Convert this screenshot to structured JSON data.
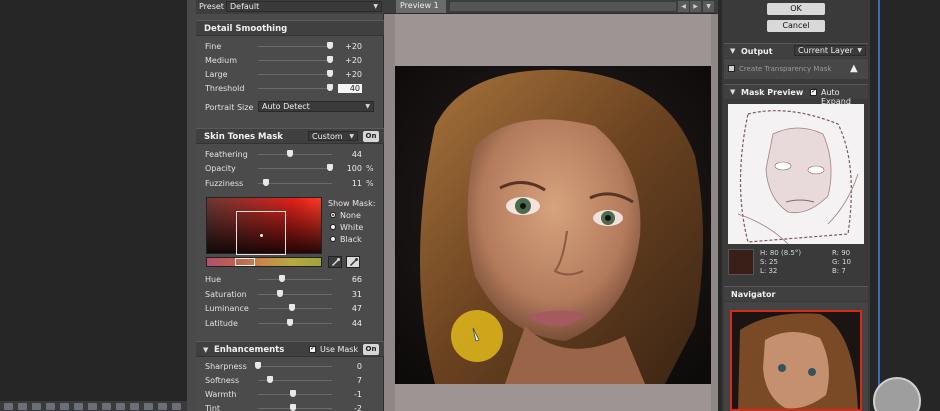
{
  "preset": {
    "label": "Preset",
    "value": "Default"
  },
  "detail_smoothing": {
    "title": "Detail Smoothing",
    "sliders": [
      {
        "label": "Fine",
        "value": "+20",
        "level": 1.0
      },
      {
        "label": "Medium",
        "value": "+20",
        "level": 1.0
      },
      {
        "label": "Large",
        "value": "+20",
        "level": 1.0
      },
      {
        "label": "Threshold",
        "value": "40",
        "level": 1.0
      }
    ],
    "portrait_size": {
      "label": "Portrait Size",
      "value": "Auto Detect"
    }
  },
  "skin_tones_mask": {
    "title": "Skin Tones Mask",
    "mode": "Custom",
    "on_label": "On",
    "sliders": [
      {
        "label": "Feathering",
        "value": "44",
        "unit": "",
        "level": 0.44
      },
      {
        "label": "Opacity",
        "value": "100",
        "unit": "%",
        "level": 1.0
      },
      {
        "label": "Fuzziness",
        "value": "11",
        "unit": "%",
        "level": 0.11
      }
    ],
    "show_mask": {
      "label": "Show Mask:",
      "options": [
        "None",
        "White",
        "Black"
      ],
      "selected": "None"
    },
    "hsl_sliders": [
      {
        "label": "Hue",
        "value": "66",
        "level": 0.33
      },
      {
        "label": "Saturation",
        "value": "31",
        "level": 0.31
      },
      {
        "label": "Luminance",
        "value": "47",
        "level": 0.47
      },
      {
        "label": "Latitude",
        "value": "44",
        "level": 0.44
      }
    ]
  },
  "enhancements": {
    "title": "Enhancements",
    "use_mask_label": "Use Mask",
    "on_label": "On",
    "sliders": [
      {
        "label": "Sharpness",
        "value": "0",
        "level": 0.0
      },
      {
        "label": "Softness",
        "value": "7",
        "level": 0.17
      },
      {
        "label": "Warmth",
        "value": "-1",
        "level": 0.49
      },
      {
        "label": "Tint",
        "value": "-2",
        "level": 0.48
      }
    ]
  },
  "preview": {
    "tab_label": "Preview 1"
  },
  "buttons": {
    "ok": "OK",
    "cancel": "Cancel"
  },
  "output": {
    "title": "Output",
    "value": "Current Layer",
    "transparency_mask_label": "Create Transparency Mask"
  },
  "mask_preview": {
    "title": "Mask Preview",
    "auto_expand_label": "Auto Expand",
    "readout": {
      "h": "H: 80 (8.5°)",
      "s": "S: 25",
      "l": "L: 32",
      "r": "R: 90",
      "g": "G: 10",
      "b": "B: 7"
    }
  },
  "navigator": {
    "title": "Navigator"
  },
  "colors": {
    "panel": "#4b4b4b",
    "accent_red": "#d42a1a",
    "swatch": "#3a1f18"
  }
}
